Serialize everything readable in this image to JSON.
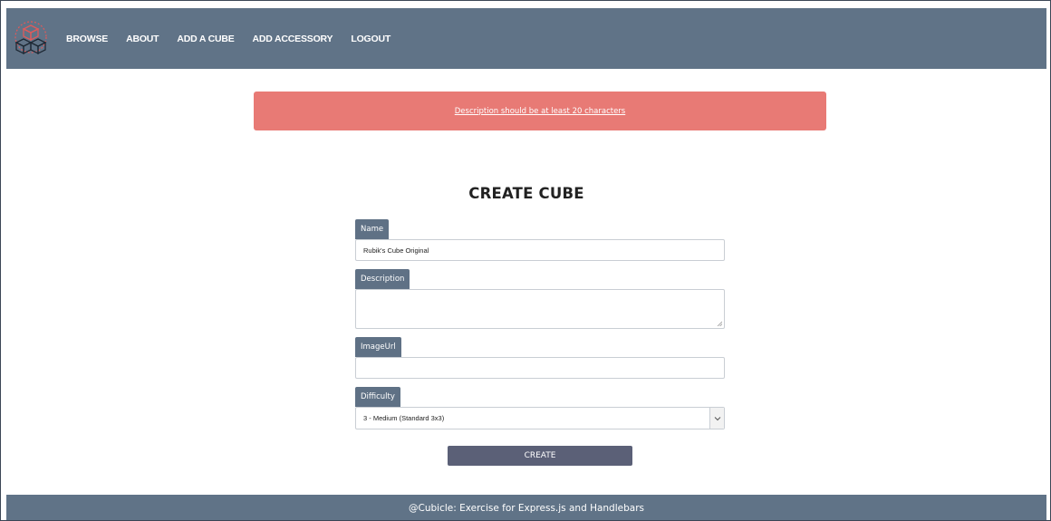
{
  "navbar": {
    "logo_icon": "cube-stack-logo-icon",
    "links": [
      "BROWSE",
      "ABOUT",
      "ADD A CUBE",
      "ADD ACCESSORY",
      "LOGOUT"
    ]
  },
  "alert": {
    "message": "Description should be at least 20 characters"
  },
  "form": {
    "title": "CREATE CUBE",
    "name": {
      "label": "Name",
      "value": "Rubik's Cube Original"
    },
    "description": {
      "label": "Description",
      "value": ""
    },
    "image_url": {
      "label": "ImageUrl",
      "value": ""
    },
    "difficulty": {
      "label": "Difficulty",
      "selected": "3 - Medium (Standard 3x3)"
    },
    "submit_label": "CREATE"
  },
  "footer": {
    "text": "@Cubicle: Exercise for Express.js and Handlebars"
  },
  "colors": {
    "navbar": "#607387",
    "alert": "#e87a75",
    "label": "#5f7185",
    "button": "#5b6077"
  }
}
